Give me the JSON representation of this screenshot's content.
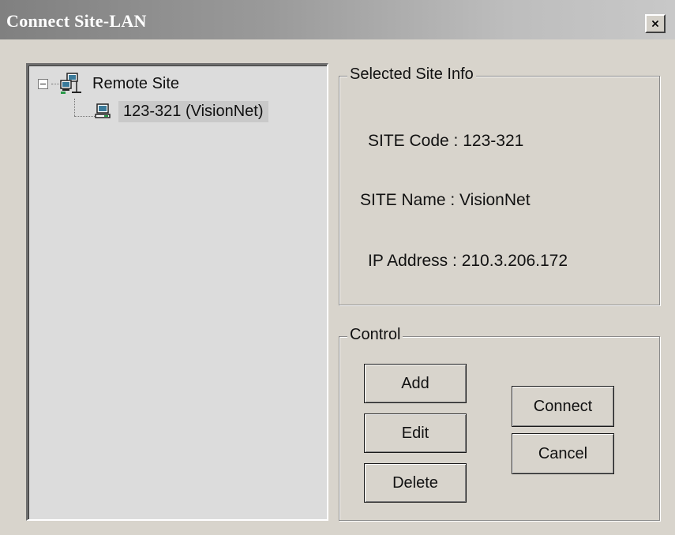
{
  "window": {
    "title": "Connect Site-LAN",
    "close_icon": "close-icon"
  },
  "tree": {
    "root": {
      "label": "Remote Site",
      "icon": "network-icon",
      "expanded": true
    },
    "children": [
      {
        "label": "123-321 (VisionNet)",
        "icon": "computer-icon",
        "selected": true
      }
    ]
  },
  "site_info": {
    "group_title": "Selected Site Info",
    "code_label": "SITE Code :",
    "code_value": "123-321",
    "name_label": "SITE Name :",
    "name_value": "VisionNet",
    "ip_label": "IP Address :",
    "ip_value": "210.3.206.172"
  },
  "control": {
    "group_title": "Control",
    "add_label": "Add",
    "edit_label": "Edit",
    "delete_label": "Delete",
    "connect_label": "Connect",
    "cancel_label": "Cancel"
  },
  "colors": {
    "dialog_bg": "#d8d4cc",
    "tree_bg": "#dcdcdc",
    "title_text": "#ffffff"
  }
}
